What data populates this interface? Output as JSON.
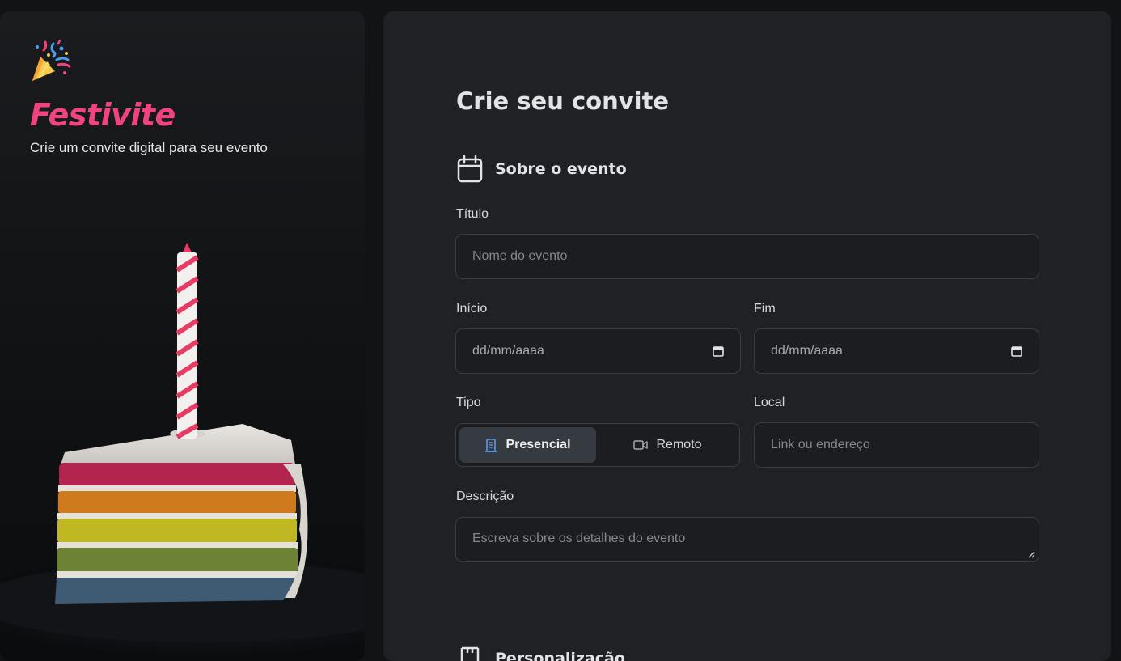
{
  "brand": {
    "name": "Festivite",
    "tagline": "Crie um convite digital para seu evento"
  },
  "form": {
    "title": "Crie seu convite",
    "section_event": {
      "title": "Sobre o evento",
      "icon": "calendar-icon"
    },
    "titulo": {
      "label": "Título",
      "placeholder": "Nome do evento"
    },
    "inicio": {
      "label": "Início",
      "value": "dd/mm/aaaa"
    },
    "fim": {
      "label": "Fim",
      "value": "dd/mm/aaaa"
    },
    "tipo": {
      "label": "Tipo",
      "options": [
        {
          "label": "Presencial",
          "icon": "building-icon",
          "selected": true
        },
        {
          "label": "Remoto",
          "icon": "video-icon",
          "selected": false
        }
      ]
    },
    "local": {
      "label": "Local",
      "placeholder": "Link ou endereço"
    },
    "descricao": {
      "label": "Descrição",
      "placeholder": "Escreva sobre os detalhes do evento"
    },
    "section_custom": {
      "title": "Personalização",
      "icon": "palette-icon"
    }
  },
  "colors": {
    "accent": "#f0437f",
    "panel": "#1f2125",
    "background": "#121315"
  }
}
